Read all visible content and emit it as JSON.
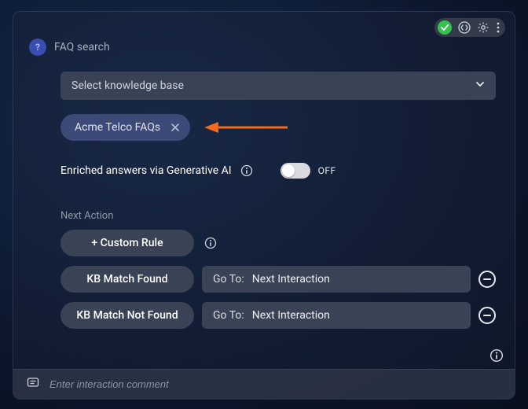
{
  "header": {
    "title": "FAQ search",
    "icon_glyph": "?"
  },
  "select_kb": {
    "placeholder": "Select knowledge base"
  },
  "chip": {
    "label": "Acme Telco FAQs"
  },
  "enriched": {
    "label": "Enriched answers via Generative AI",
    "toggle_state": "OFF"
  },
  "next_action": {
    "section_label": "Next Action",
    "custom_rule_label": "+ Custom Rule",
    "rules": [
      {
        "name": "KB Match Found",
        "goto_label": "Go To:",
        "goto_value": "Next Interaction"
      },
      {
        "name": "KB Match Not Found",
        "goto_label": "Go To:",
        "goto_value": "Next Interaction"
      }
    ]
  },
  "footer": {
    "comment_placeholder": "Enter interaction comment"
  },
  "colors": {
    "arrow": "#f26a1b",
    "status_ok": "#32c24d"
  }
}
